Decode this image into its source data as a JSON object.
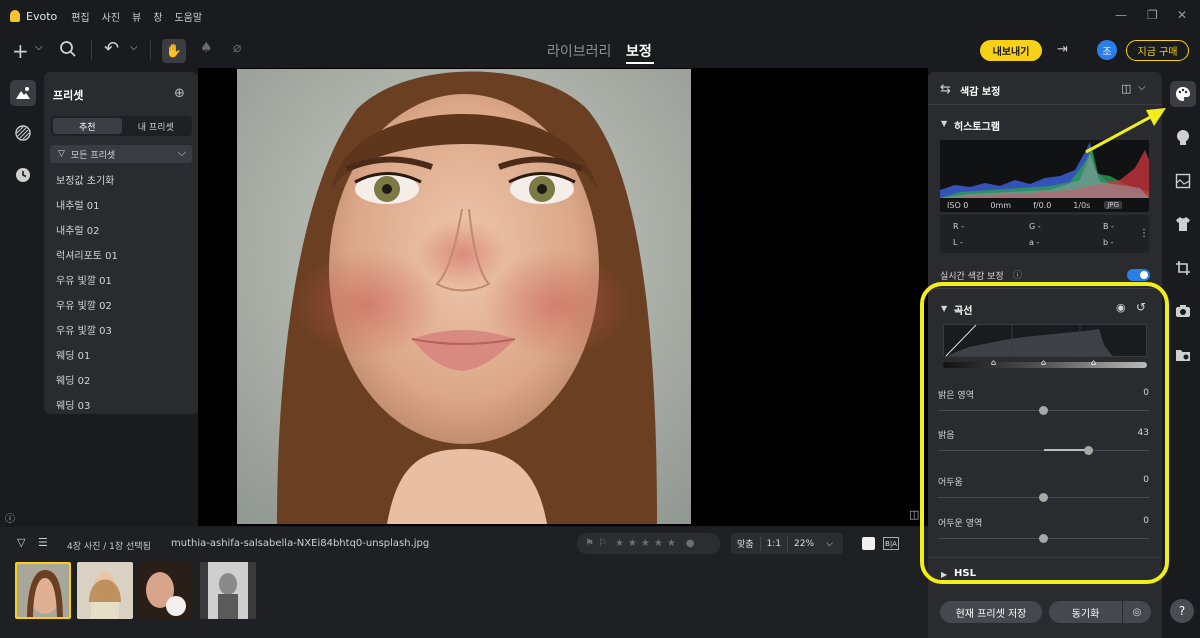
{
  "app": {
    "name": "Evoto",
    "menu": [
      "편집",
      "사진",
      "뷰",
      "창",
      "도움말"
    ]
  },
  "toolbar": {
    "tabs": {
      "library": "라이브러리",
      "edit": "보정"
    },
    "export_label": "내보내기",
    "avatar_initial": "조",
    "buy_label": "지금 구매"
  },
  "presets": {
    "title": "프리셋",
    "segments": [
      "추천",
      "내 프리셋"
    ],
    "filter": "모든 프리셋",
    "items": [
      "보정값 초기화",
      "내추럴 01",
      "내추럴 02",
      "럭셔리포토 01",
      "우유 빛깔 01",
      "우유 빛깔 02",
      "우유 빛깔 03",
      "웨딩 01",
      "웨딩 02",
      "웨딩 03"
    ]
  },
  "filmstrip": {
    "count_text": "4장 사진 / 1장 선택됨",
    "file_name": "muthia-ashifa-salsabella-NXEi84bhtq0-unsplash.jpg",
    "zoom": {
      "fit": "맞춤",
      "one_to_one": "1:1",
      "percent": "22%"
    },
    "ba_label": "B|A"
  },
  "panel": {
    "header": "색감 보정",
    "histogram": {
      "title": "히스토그램",
      "iso": "ISO 0",
      "focal": "0mm",
      "aperture": "f/0.0",
      "shutter": "1/0s",
      "format": "JPG",
      "r": "R -",
      "g": "G -",
      "b": "B -",
      "l": "L -",
      "a": "a -",
      "b2": "b -"
    },
    "realtime_label": "실시간 색감 보정",
    "curve": {
      "title": "곡선",
      "sliders": [
        {
          "label": "밝은 영역",
          "value": "0",
          "fraction": 0.5
        },
        {
          "label": "밝음",
          "value": "43",
          "fraction": 0.715
        },
        {
          "label": "어두움",
          "value": "0",
          "fraction": 0.5
        },
        {
          "label": "어두운 영역",
          "value": "0",
          "fraction": 0.5
        }
      ]
    },
    "hsl_title": "HSL",
    "save_preset": "현재 프리셋 저장",
    "sync": "동기화"
  },
  "colors": {
    "accent_yellow": "#f7d117",
    "highlight": "#f2ee1c",
    "toggle_blue": "#2b7de9"
  }
}
